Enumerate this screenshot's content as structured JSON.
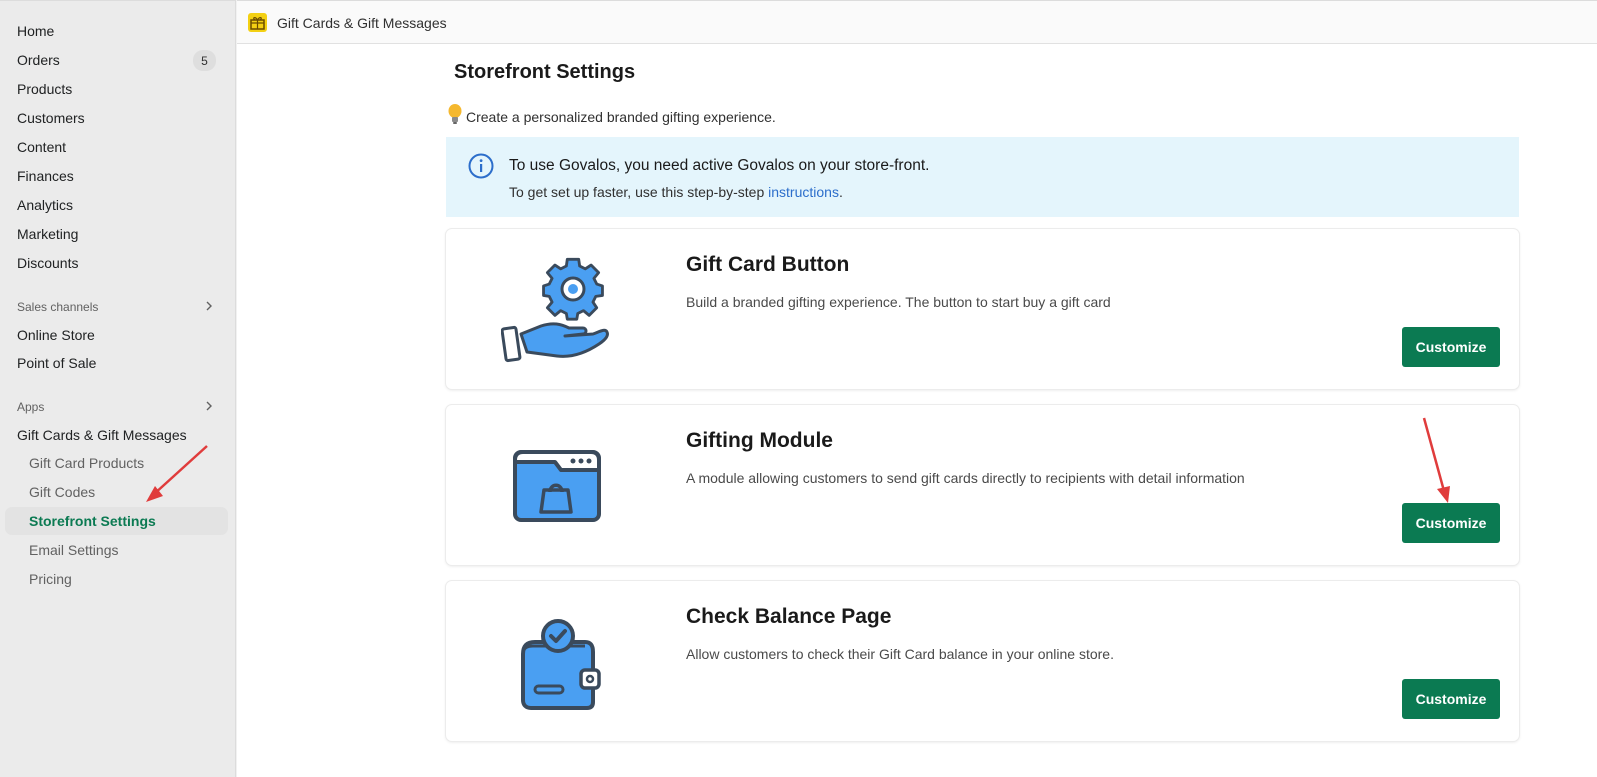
{
  "sidebar": {
    "nav": [
      {
        "label": "Home"
      },
      {
        "label": "Orders",
        "badge": "5"
      },
      {
        "label": "Products"
      },
      {
        "label": "Customers"
      },
      {
        "label": "Content"
      },
      {
        "label": "Finances"
      },
      {
        "label": "Analytics"
      },
      {
        "label": "Marketing"
      },
      {
        "label": "Discounts"
      }
    ],
    "sales_channels_label": "Sales channels",
    "sales_channels": [
      {
        "label": "Online Store"
      },
      {
        "label": "Point of Sale"
      }
    ],
    "apps_label": "Apps",
    "app_name": "Gift Cards & Gift Messages",
    "app_subitems": [
      {
        "label": "Gift Card Products"
      },
      {
        "label": "Gift Codes"
      },
      {
        "label": "Storefront Settings",
        "active": true
      },
      {
        "label": "Email Settings"
      },
      {
        "label": "Pricing"
      }
    ]
  },
  "topbar": {
    "title": "Gift Cards & Gift Messages",
    "logo_text": "🎁"
  },
  "page": {
    "title": "Storefront Settings",
    "subtitle": "Create a personalized branded gifting experience."
  },
  "banner": {
    "title": "To use Govalos, you need active Govalos on your store-front.",
    "text_prefix": "To get set up faster, use this step-by-step ",
    "link": "instructions",
    "text_suffix": "."
  },
  "cards": [
    {
      "title": "Gift Card Button",
      "description": "Build a branded gifting experience. The button to start buy a gift card",
      "button": "Customize",
      "icon": "gear-hand-icon"
    },
    {
      "title": "Gifting Module",
      "description": "A module allowing customers to send gift cards directly to recipients with detail information",
      "button": "Customize",
      "icon": "browser-folder-bag-icon"
    },
    {
      "title": "Check Balance Page",
      "description": "Allow customers to check their Gift Card balance in your online store.",
      "button": "Customize",
      "icon": "wallet-check-icon"
    }
  ],
  "colors": {
    "accent": "#0b7a52",
    "icon_blue": "#4a9ff2",
    "icon_outline": "#3a4a5c",
    "annotation_arrow": "#e03c3c",
    "banner_bg": "#e4f5fc"
  }
}
